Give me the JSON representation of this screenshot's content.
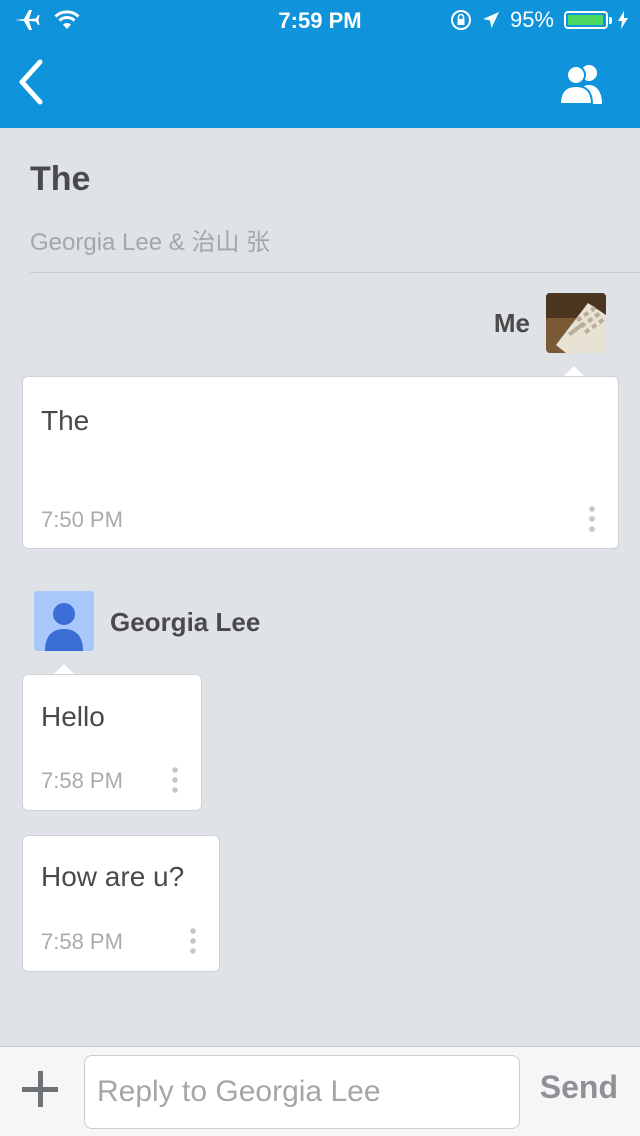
{
  "status_bar": {
    "time": "7:59 PM",
    "battery_text": "95%",
    "battery_level": 0.95
  },
  "nav": {
    "back_icon": "chevron-left-icon",
    "participants_icon": "people-icon",
    "color": "#0f93da"
  },
  "conversation": {
    "title": "The",
    "participants": "Georgia Lee & 治山 张"
  },
  "me": {
    "label": "Me"
  },
  "messages": [
    {
      "sender": "Me",
      "text": "The",
      "time": "7:50 PM"
    },
    {
      "sender": "Georgia Lee",
      "text": "Hello",
      "time": "7:58 PM"
    },
    {
      "sender": "Georgia Lee",
      "text": "How are u?",
      "time": "7:58 PM"
    }
  ],
  "georgia": {
    "name": "Georgia Lee"
  },
  "composer": {
    "placeholder": "Reply to Georgia Lee",
    "value": "",
    "send_label": "Send"
  }
}
